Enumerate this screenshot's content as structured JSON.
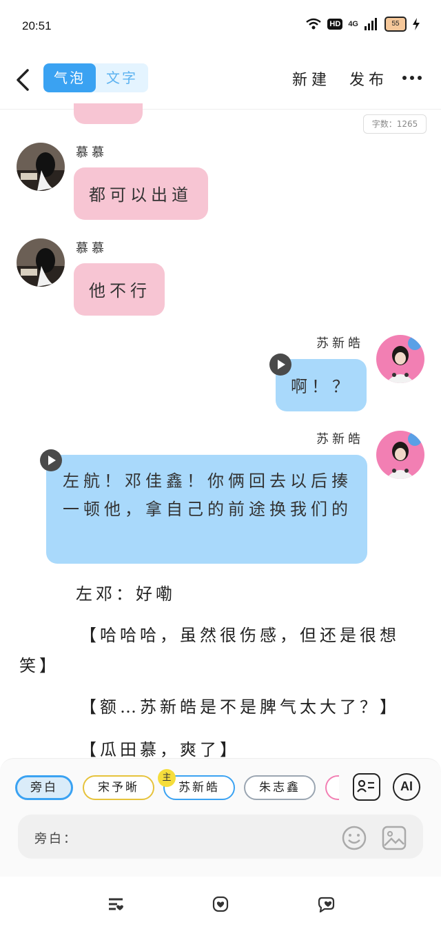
{
  "status_bar": {
    "time": "20:51",
    "hd_label": "HD",
    "network_label": "4G",
    "battery_label": "55"
  },
  "header": {
    "tabs": [
      {
        "label": "气泡",
        "active": true
      },
      {
        "label": "文字",
        "active": false
      }
    ],
    "new_label": "新建",
    "publish_label": "发布"
  },
  "word_count": "字数：1265",
  "messages": [
    {
      "speaker": "慕慕",
      "text": "都可以出道",
      "side": "left",
      "color": "pink"
    },
    {
      "speaker": "慕慕",
      "text": "他不行",
      "side": "left",
      "color": "pink"
    },
    {
      "speaker": "苏新皓",
      "text": "啊！？",
      "side": "right",
      "color": "blue",
      "voice": true
    },
    {
      "speaker": "苏新皓",
      "text": "左航！邓佳鑫！你俩回去以后揍一顿他，拿自己的前途换我们的",
      "side": "right",
      "color": "blue",
      "voice": true
    }
  ],
  "narrations": [
    "左邓：好嘞",
    "【哈哈哈，虽然很伤感，但还是很想笑】",
    "【额…苏新皓是不是脾气太大了？】",
    "【瓜田慕，爽了】"
  ],
  "roles": [
    {
      "label": "旁白",
      "selected": true
    },
    {
      "label": "宋予晰",
      "selected": false
    },
    {
      "label": "苏新皓",
      "selected": false,
      "badge": "主"
    },
    {
      "label": "朱志鑫",
      "selected": false
    }
  ],
  "ai_label": "AI",
  "input": {
    "prefix": "旁白："
  },
  "colors": {
    "accent_blue": "#3aa2f2",
    "pink_bubble": "#f7c5d3",
    "blue_bubble": "#a9d9fb",
    "chip_yellow": "#e6c23a"
  },
  "icons": [
    "back-icon",
    "more-icon",
    "play-icon",
    "contacts-icon",
    "emoji-icon",
    "image-icon",
    "list-icon",
    "heart-icon",
    "chat-heart-icon"
  ]
}
